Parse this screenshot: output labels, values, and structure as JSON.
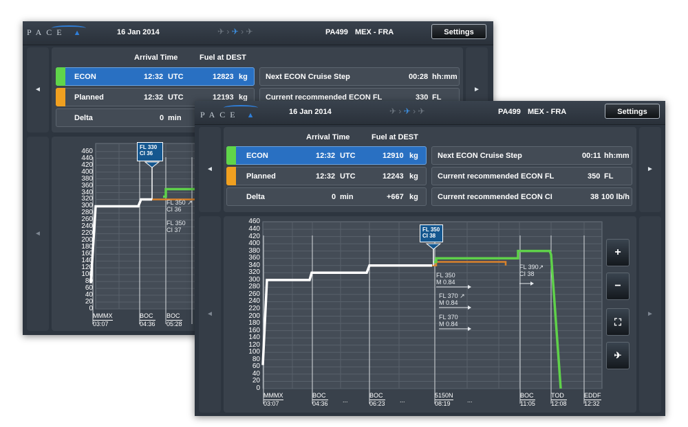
{
  "colors": {
    "econ": "#60d54a",
    "planned": "#f0a020",
    "selected_row": "#2970c2",
    "econ_line": "#5fd14a",
    "planned_line": "#d9822b",
    "baseline": "#ffffff"
  },
  "back": {
    "logo": "PACE",
    "date": "16 Jan 2014",
    "flight": "PA499",
    "route": "MEX - FRA",
    "settings": "Settings",
    "phase_icons": [
      "takeoff-icon",
      "cruise-icon",
      "landing-icon"
    ],
    "col_arrival": "Arrival Time",
    "col_fuel": "Fuel at DEST",
    "rows": [
      {
        "name": "ECON",
        "time": "12:32",
        "tunit": "UTC",
        "fuel": "12823",
        "funit": "kg"
      },
      {
        "name": "Planned",
        "time": "12:32",
        "tunit": "UTC",
        "fuel": "12193",
        "funit": "kg"
      },
      {
        "name": "Delta",
        "time": "0",
        "tunit": "min",
        "fuel": "",
        "funit": ""
      }
    ],
    "info": [
      {
        "label": "Next ECON Cruise Step",
        "value": "00:28",
        "unit": "hh:mm"
      },
      {
        "label": "Current recommended ECON FL",
        "value": "330",
        "unit": "FL"
      }
    ],
    "nav_left": "◄",
    "nav_right": "►",
    "yticks": [
      "460",
      "440",
      "420",
      "400",
      "380",
      "360",
      "340",
      "320",
      "300",
      "280",
      "260",
      "240",
      "220",
      "200",
      "180",
      "160",
      "140",
      "120",
      "100",
      "80",
      "60",
      "40",
      "20",
      "0"
    ],
    "flag": {
      "l1": "FL 330",
      "l2": "CI 36"
    },
    "annotations": [
      {
        "l1": "FL 350 ↗",
        "l2": "CI 36"
      },
      {
        "l1": "FL 350",
        "l2": "CI 37"
      }
    ],
    "waypoints": [
      {
        "name": "MMMX",
        "time": "03:07"
      },
      {
        "name": "BOC",
        "time": "04:36"
      },
      {
        "name": "BOC",
        "time": "05:28"
      }
    ]
  },
  "front": {
    "logo": "PACE",
    "date": "16 Jan 2014",
    "flight": "PA499",
    "route": "MEX - FRA",
    "settings": "Settings",
    "phase_icons": [
      "takeoff-icon",
      "cruise-icon",
      "landing-icon"
    ],
    "col_arrival": "Arrival Time",
    "col_fuel": "Fuel at DEST",
    "rows": [
      {
        "name": "ECON",
        "time": "12:32",
        "tunit": "UTC",
        "fuel": "12910",
        "funit": "kg"
      },
      {
        "name": "Planned",
        "time": "12:32",
        "tunit": "UTC",
        "fuel": "12243",
        "funit": "kg"
      },
      {
        "name": "Delta",
        "time": "0",
        "tunit": "min",
        "fuel": "+667",
        "funit": "kg"
      }
    ],
    "info": [
      {
        "label": "Next ECON Cruise Step",
        "value": "00:11",
        "unit": "hh:mm"
      },
      {
        "label": "Current recommended ECON FL",
        "value": "350",
        "unit": "FL"
      },
      {
        "label": "Current recommended ECON CI",
        "value": "38",
        "unit": "100 lb/h"
      }
    ],
    "nav_left": "◄",
    "nav_right": "►",
    "yticks": [
      "460",
      "440",
      "420",
      "400",
      "380",
      "360",
      "340",
      "320",
      "300",
      "280",
      "260",
      "240",
      "220",
      "200",
      "180",
      "160",
      "140",
      "120",
      "100",
      "80",
      "60",
      "40",
      "20",
      "0"
    ],
    "flag": {
      "l1": "FL 350",
      "l2": "CI 38"
    },
    "annotations": [
      {
        "l1": "FL 350",
        "l2": "M 0.84"
      },
      {
        "l1": "FL 370 ↗",
        "l2": "M 0.84"
      },
      {
        "l1": "FL 370",
        "l2": "M 0.84"
      },
      {
        "l1": "FL 390↗",
        "l2": "CI 38"
      }
    ],
    "waypoints": [
      {
        "name": "MMMX",
        "time": "03:07"
      },
      {
        "name": "BOC",
        "time": "04:36"
      },
      {
        "name": "BOC",
        "time": "06:23"
      },
      {
        "name": "5150N",
        "time": "08:19"
      },
      {
        "name": "BOC",
        "time": "11:05"
      },
      {
        "name": "TOD",
        "time": "12:08"
      },
      {
        "name": "EDDF",
        "time": "12:32"
      }
    ],
    "ellipsis": "...",
    "controls": [
      {
        "name": "zoom-in-button",
        "label": "+"
      },
      {
        "name": "zoom-out-button",
        "label": "−"
      },
      {
        "name": "fit-view-button",
        "label": "⛶"
      },
      {
        "name": "center-aircraft-button",
        "label": "✈"
      }
    ]
  }
}
